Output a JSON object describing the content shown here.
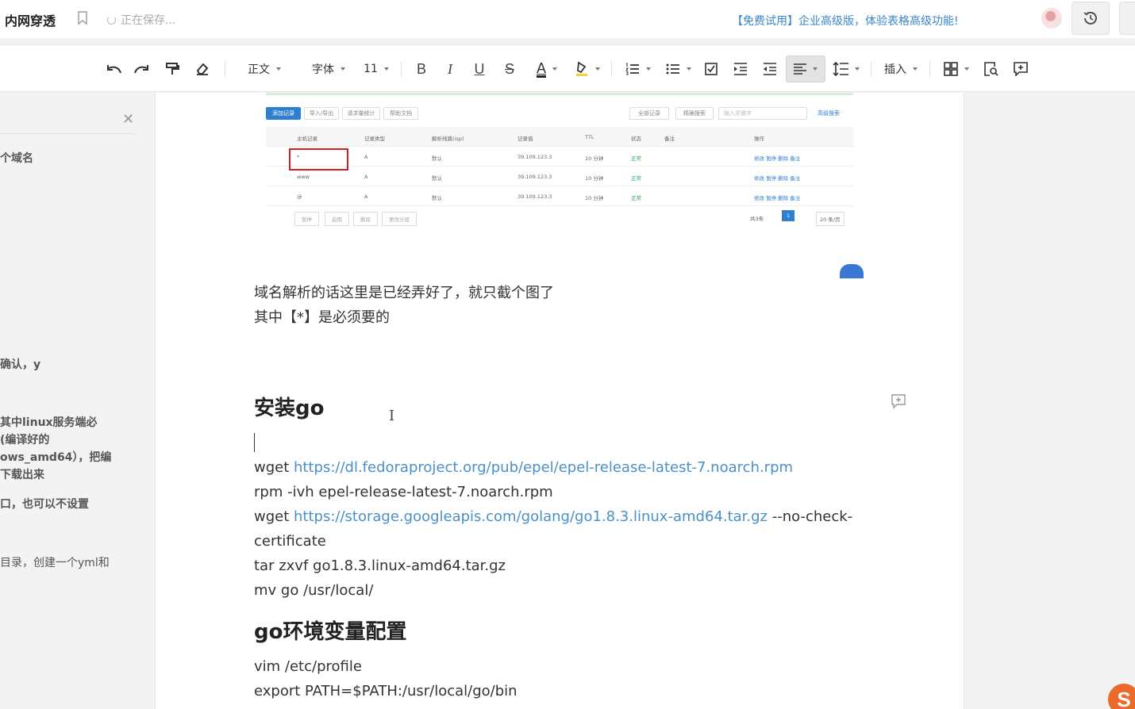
{
  "topbar": {
    "title": "内网穿透",
    "saving_status": "正在保存...",
    "promo": "【免费试用】企业高级版，体验表格高级功能!"
  },
  "toolbar": {
    "style_label": "正文",
    "font_label": "字体",
    "size_label": "11",
    "bold": "B",
    "italic": "I",
    "underline": "U",
    "strike": "S",
    "font_color": "A",
    "insert_label": "插入"
  },
  "sidebar": {
    "items": [
      {
        "label": "个域名"
      },
      {
        "label": "确认，y"
      },
      {
        "label": " 其中linux服务端必"
      },
      {
        "label": "(编译好的"
      },
      {
        "label": "ows_amd64），把编"
      },
      {
        "label": "下载出来"
      },
      {
        "label": "口，也可以不设置"
      },
      {
        "label": "目录，创建一个yml和"
      }
    ]
  },
  "embed": {
    "buttons": [
      "添加记录",
      "导入/导出",
      "请求量统计",
      "帮助文档"
    ],
    "filter_label": "全部记录",
    "search_mode": "精确搜索",
    "search_placeholder": "输入关键字",
    "advanced_search": "高级搜索",
    "headers": [
      "主机记录",
      "记录类型",
      "解析线路(isp)",
      "记录值",
      "TTL",
      "状态",
      "备注",
      "操作"
    ],
    "rows": [
      {
        "host": "*",
        "type": "A",
        "line": "默认",
        "value": "39.109.123.3",
        "ttl": "10 分钟",
        "status": "正常",
        "ops": "修改  暂停  删除  备注"
      },
      {
        "host": "www",
        "type": "A",
        "line": "默认",
        "value": "39.109.123.3",
        "ttl": "10 分钟",
        "status": "正常",
        "ops": "修改  暂停  删除  备注"
      },
      {
        "host": "@",
        "type": "A",
        "line": "默认",
        "value": "39.109.123.3",
        "ttl": "10 分钟",
        "status": "正常",
        "ops": "修改  暂停  删除  备注"
      }
    ],
    "footer_buttons": [
      "暂停",
      "启用",
      "删除",
      "更改分组"
    ],
    "total_label": "共3条",
    "page_current": "1",
    "page_size": "20 条/页"
  },
  "content": {
    "para1": "域名解析的话这里是已经弄好了，就只截个图了",
    "para2": "其中【*】是必须要的",
    "heading_install": "安装go",
    "line1_cmd": "wget ",
    "line1_url": "https://dl.fedoraproject.org/pub/epel/epel-release-latest-7.noarch.rpm",
    "line2": "rpm -ivh epel-release-latest-7.noarch.rpm",
    "line3_cmd": "wget ",
    "line3_url": "https://storage.googleapis.com/golang/go1.8.3.linux-amd64.tar.gz",
    "line3_tail": " --no-check-",
    "line3_wrap": "certificate",
    "line4": "tar zxvf go1.8.3.linux-amd64.tar.gz",
    "line5": "mv go /usr/local/",
    "heading_env": "go环境变量配置",
    "line6": "vim /etc/profile",
    "line7": "export PATH=$PATH:/usr/local/go/bin"
  },
  "colors": {
    "link": "#4a90c8",
    "promo": "#3a86c8",
    "highlight_box": "#d21f1f",
    "primary_button": "#2f7fd1"
  }
}
